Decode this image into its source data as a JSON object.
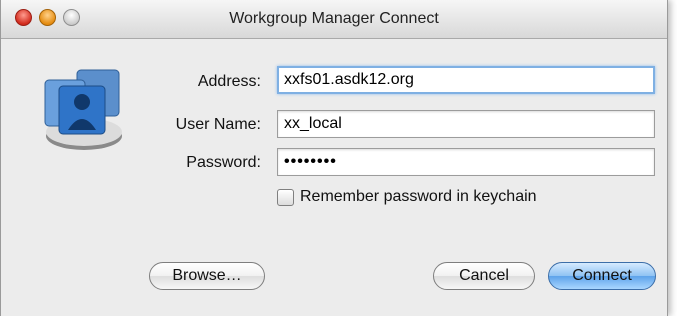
{
  "window": {
    "title": "Workgroup Manager Connect"
  },
  "form": {
    "address": {
      "label": "Address:",
      "value": "xxfs01.asdk12.org"
    },
    "username": {
      "label": "User Name:",
      "value": "xx_local"
    },
    "password": {
      "label": "Password:",
      "value": "••••••••"
    },
    "remember": {
      "label": "Remember password in keychain",
      "checked": false
    }
  },
  "buttons": {
    "browse": "Browse…",
    "cancel": "Cancel",
    "connect": "Connect"
  },
  "icons": {
    "app_icon": "workgroup-users-icon"
  }
}
